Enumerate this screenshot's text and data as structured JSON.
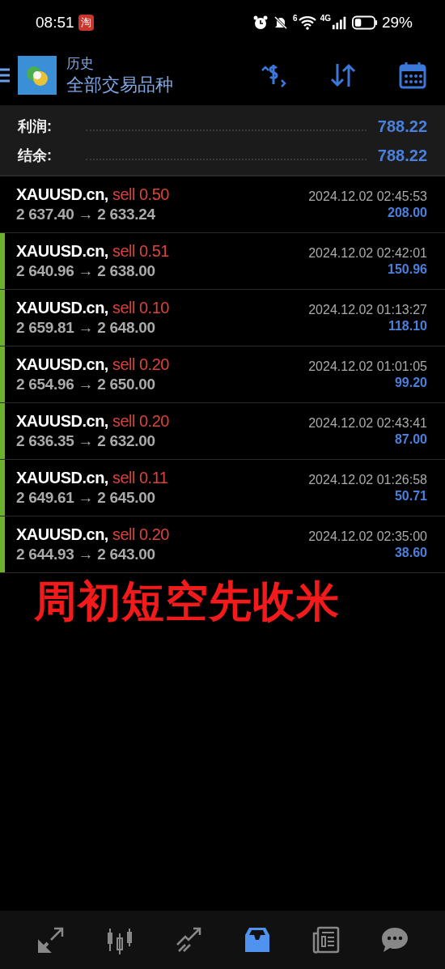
{
  "status_bar": {
    "time": "08:51",
    "app_badge": "淘",
    "network": "4G",
    "signal_extra": "6",
    "battery": "29%"
  },
  "header": {
    "title": "历史",
    "subtitle": "全部交易品种"
  },
  "summary": [
    {
      "label": "利润:",
      "value": "788.22"
    },
    {
      "label": "结余:",
      "value": "788.22"
    }
  ],
  "deals": [
    {
      "symbol": "XAUUSD.cn,",
      "side": "sell 0.50",
      "prices": "2 637.40 → 2 633.24",
      "time": "2024.12.02 02:45:53",
      "profit": "208.00",
      "highlighted": false
    },
    {
      "symbol": "XAUUSD.cn,",
      "side": "sell 0.51",
      "prices": "2 640.96 → 2 638.00",
      "time": "2024.12.02 02:42:01",
      "profit": "150.96",
      "highlighted": true
    },
    {
      "symbol": "XAUUSD.cn,",
      "side": "sell 0.10",
      "prices": "2 659.81 → 2 648.00",
      "time": "2024.12.02 01:13:27",
      "profit": "118.10",
      "highlighted": true
    },
    {
      "symbol": "XAUUSD.cn,",
      "side": "sell 0.20",
      "prices": "2 654.96 → 2 650.00",
      "time": "2024.12.02 01:01:05",
      "profit": "99.20",
      "highlighted": true
    },
    {
      "symbol": "XAUUSD.cn,",
      "side": "sell 0.20",
      "prices": "2 636.35 → 2 632.00",
      "time": "2024.12.02 02:43:41",
      "profit": "87.00",
      "highlighted": true
    },
    {
      "symbol": "XAUUSD.cn,",
      "side": "sell 0.11",
      "prices": "2 649.61 → 2 645.00",
      "time": "2024.12.02 01:26:58",
      "profit": "50.71",
      "highlighted": true
    },
    {
      "symbol": "XAUUSD.cn,",
      "side": "sell 0.20",
      "prices": "2 644.93 → 2 643.00",
      "time": "2024.12.02 02:35:00",
      "profit": "38.60",
      "highlighted": true
    }
  ],
  "caption": "周初短空先收米",
  "bottom_nav": [
    {
      "kind": "quotes",
      "selected": false
    },
    {
      "kind": "chart",
      "selected": false
    },
    {
      "kind": "trade",
      "selected": false
    },
    {
      "kind": "history",
      "selected": true
    },
    {
      "kind": "news",
      "selected": false
    },
    {
      "kind": "chat",
      "selected": false
    }
  ]
}
